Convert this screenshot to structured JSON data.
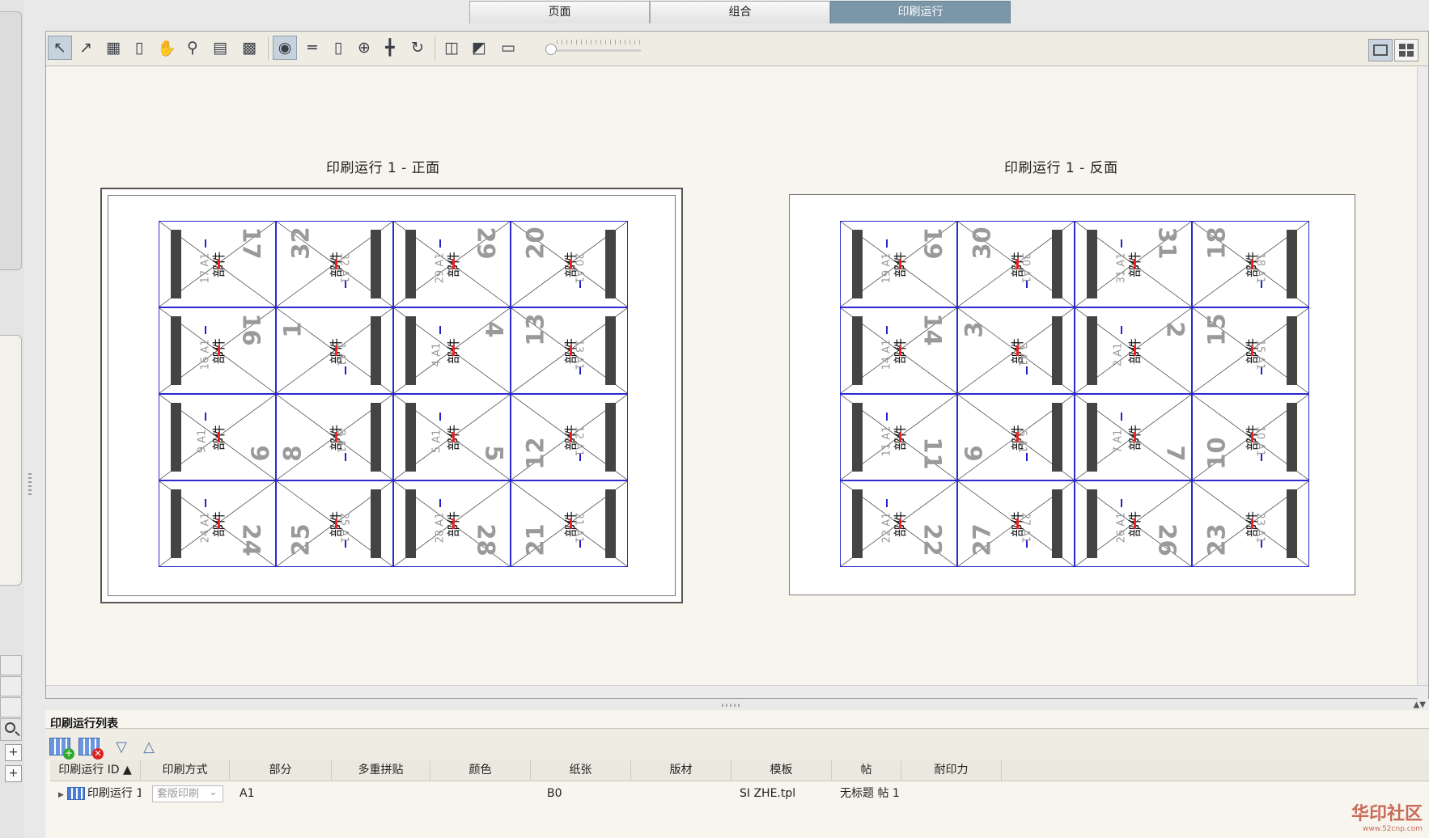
{
  "tabs": [
    {
      "label": "页面",
      "active": false
    },
    {
      "label": "组合",
      "active": false
    },
    {
      "label": "印刷运行",
      "active": true
    }
  ],
  "toolbar": {
    "icons": [
      "arrow-select-icon",
      "direct-select-icon",
      "page-number-icon",
      "page-insert-icon",
      "hand-icon",
      "zoom-icon",
      "layout-dropdown-icon",
      "color-marks-icon",
      "view-eye-icon",
      "ruler-icon",
      "page-icon",
      "crosshair-icon",
      "align-icon",
      "rotate-icon",
      "split-view-icon",
      "flip-icon",
      "comment-icon"
    ]
  },
  "sheets": [
    {
      "title": "印刷运行 1 - 正面",
      "tiles": [
        [
          "17",
          "32",
          "29",
          "20"
        ],
        [
          "16",
          "1",
          "4",
          "13"
        ],
        [
          "9",
          "8",
          "5",
          "12"
        ],
        [
          "24",
          "25",
          "28",
          "21"
        ]
      ]
    },
    {
      "title": "印刷运行 1 - 反面",
      "tiles": [
        [
          "19",
          "30",
          "31",
          "18"
        ],
        [
          "14",
          "3",
          "2",
          "15"
        ],
        [
          "11",
          "6",
          "7",
          "10"
        ],
        [
          "22",
          "27",
          "26",
          "23"
        ]
      ]
    }
  ],
  "tile_label": "部件",
  "tile_code": "A1",
  "bottom": {
    "title": "印刷运行列表",
    "columns": [
      "印刷运行 ID ▲",
      "印刷方式",
      "部分",
      "多重拼贴",
      "颜色",
      "纸张",
      "版材",
      "模板",
      "帖",
      "耐印力"
    ],
    "row": {
      "id": "印刷运行 1",
      "method": "套版印刷",
      "part": "A1",
      "multi": "",
      "color": "",
      "paper": "B0",
      "plate": "",
      "template": "SI ZHE.tpl",
      "signature": "无标题 帖 1",
      "runlength": ""
    }
  },
  "watermark": {
    "title": "华印社区",
    "url": "www.52cnp.com"
  },
  "colors": {
    "tab_active": "#7b96a8",
    "tile_border": "#2a2ad0",
    "bar": "#444444",
    "page_number": "#9a9a9a"
  }
}
